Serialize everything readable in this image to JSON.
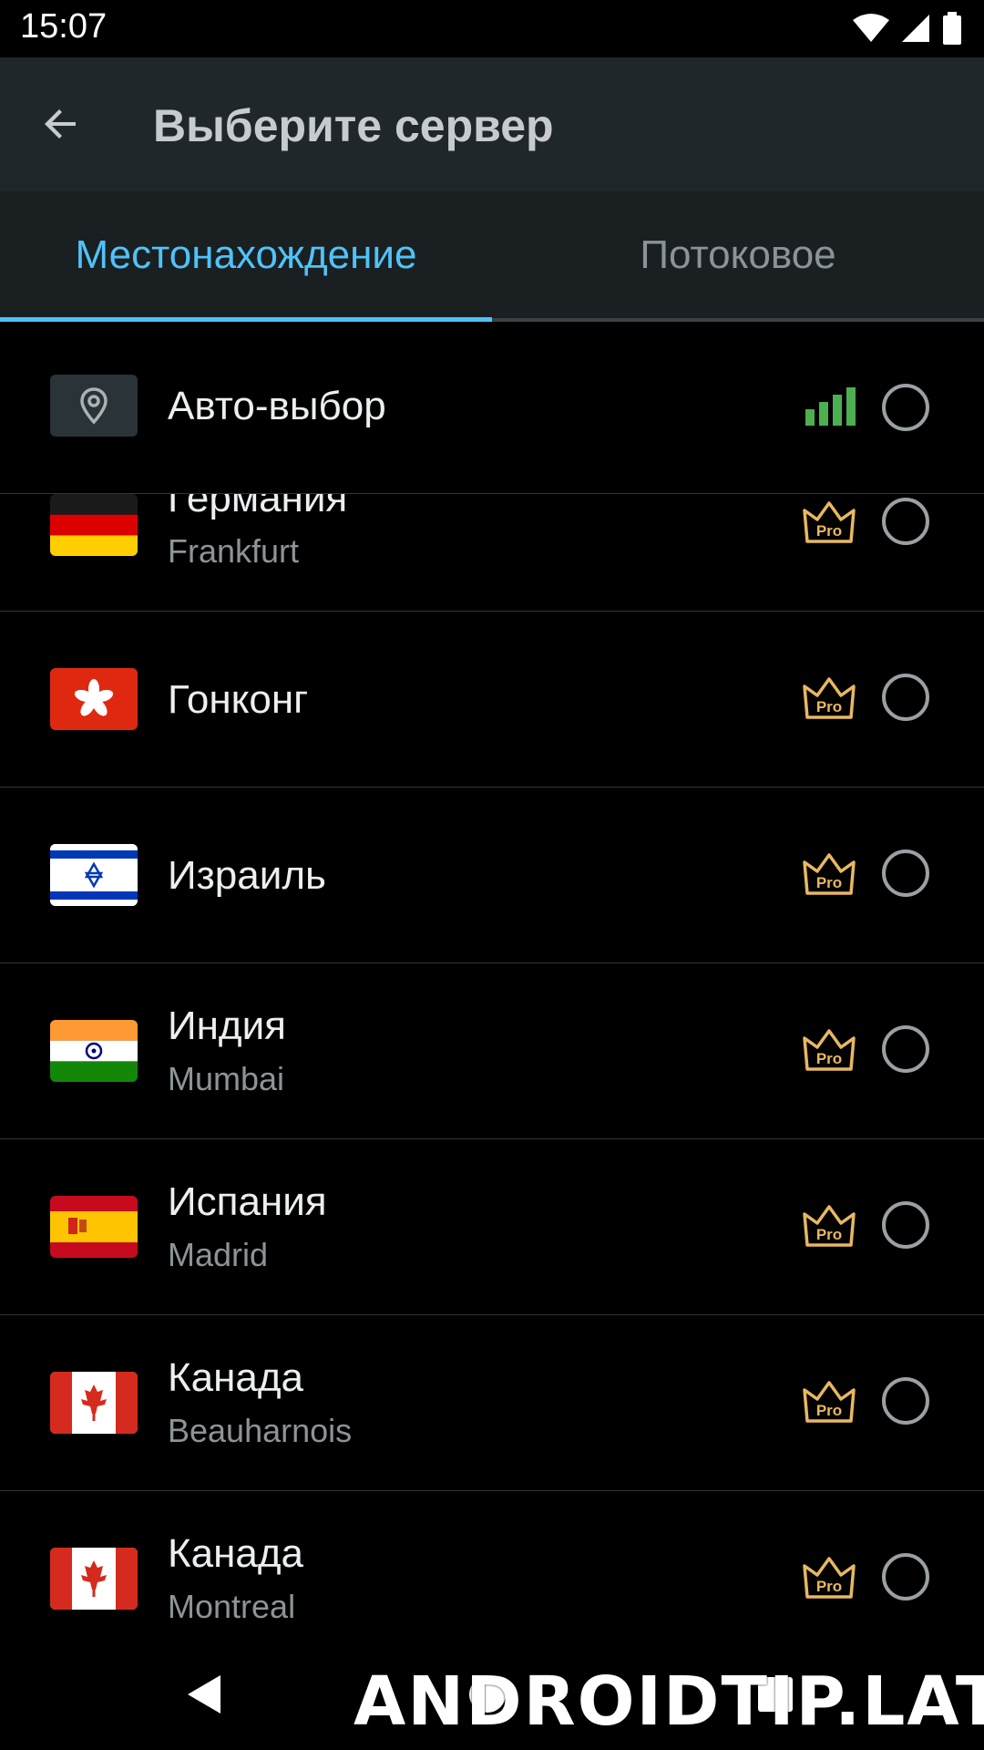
{
  "status_bar": {
    "time": "15:07"
  },
  "app_bar": {
    "title": "Выберите сервер"
  },
  "tabs": [
    {
      "label": "Местонахождение",
      "selected": true
    },
    {
      "label": "Потоковое",
      "selected": false
    }
  ],
  "colors": {
    "accent": "#4fc3f7",
    "pro_gold": "#e8b860",
    "signal_green": "#4caf50"
  },
  "servers": [
    {
      "name": "Авто-выбор",
      "city": "",
      "icon": "location-icon",
      "badge": "signal-icon"
    },
    {
      "name": "Германия",
      "city": "Frankfurt",
      "icon": "flag-germany-icon",
      "badge": "pro-crown-icon"
    },
    {
      "name": "Гонконг",
      "city": "",
      "icon": "flag-hongkong-icon",
      "badge": "pro-crown-icon"
    },
    {
      "name": "Израиль",
      "city": "",
      "icon": "flag-israel-icon",
      "badge": "pro-crown-icon"
    },
    {
      "name": "Индия",
      "city": "Mumbai",
      "icon": "flag-india-icon",
      "badge": "pro-crown-icon"
    },
    {
      "name": "Испания",
      "city": "Madrid",
      "icon": "flag-spain-icon",
      "badge": "pro-crown-icon"
    },
    {
      "name": "Канада",
      "city": "Beauharnois",
      "icon": "flag-canada-icon",
      "badge": "pro-crown-icon"
    },
    {
      "name": "Канада",
      "city": "Montreal",
      "icon": "flag-canada-icon",
      "badge": "pro-crown-icon"
    }
  ],
  "pro_badge_text": "Pro",
  "watermark": "ANDROIDTIP.LAT"
}
